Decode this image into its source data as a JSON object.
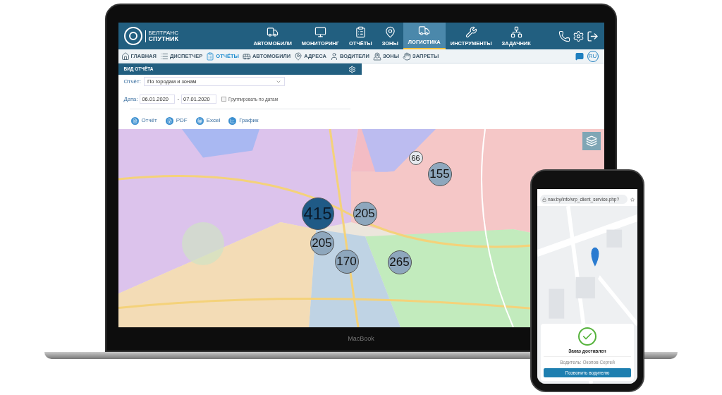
{
  "brand": {
    "line1": "БЕЛТРАНС",
    "line2": "СПУТНИК"
  },
  "main_nav": [
    {
      "label": "АВТОМОБИЛИ",
      "selected": false
    },
    {
      "label": "МОНИТОРИНГ",
      "selected": false
    },
    {
      "label": "ОТЧЁТЫ",
      "selected": false
    },
    {
      "label": "ЗОНЫ",
      "selected": false
    },
    {
      "label": "ЛОГИСТИКА",
      "selected": true
    },
    {
      "label": "ИНСТРУМЕНТЫ",
      "selected": false
    },
    {
      "label": "ЗАДАЧНИК",
      "selected": false
    }
  ],
  "sub_nav": [
    {
      "label": "ГЛАВНАЯ",
      "selected": false
    },
    {
      "label": "ДИСПЕТЧЕР",
      "selected": false
    },
    {
      "label": "ОТЧЁТЫ",
      "selected": true
    },
    {
      "label": "АВТОМОБИЛИ",
      "selected": false
    },
    {
      "label": "АДРЕСА",
      "selected": false
    },
    {
      "label": "ВОДИТЕЛИ",
      "selected": false
    },
    {
      "label": "ЗОНЫ",
      "selected": false
    },
    {
      "label": "ЗАПРЕТЫ",
      "selected": false
    }
  ],
  "language": "RU",
  "panel": {
    "title": "ВИД ОТЧЁТА",
    "report_label": "Отчёт:",
    "report_value": "По городам и зонам",
    "date_label": "Дата:",
    "date_from": "06.01.2020",
    "date_separator": "-",
    "date_to": "07.01.2020",
    "group_by_dates": {
      "label": "Группировать по датам",
      "checked": false
    },
    "actions": [
      "Отчёт",
      "PDF",
      "Excel",
      "График"
    ]
  },
  "map": {
    "clusters": [
      {
        "count": "415",
        "kind": "large"
      },
      {
        "count": "205",
        "kind": "medium"
      },
      {
        "count": "205",
        "kind": "medium"
      },
      {
        "count": "170",
        "kind": "medium"
      },
      {
        "count": "265",
        "kind": "medium"
      },
      {
        "count": "155",
        "kind": "medium"
      },
      {
        "count": "66",
        "kind": "small"
      }
    ]
  },
  "laptop": {
    "brand": "MacBook"
  },
  "phone": {
    "url": "nav.by/info/vrp_client_service.php?",
    "status": "Заказ доставлен",
    "driver": "Водитель: Окопов Сергей",
    "call_button": "Позвонить водителю"
  }
}
